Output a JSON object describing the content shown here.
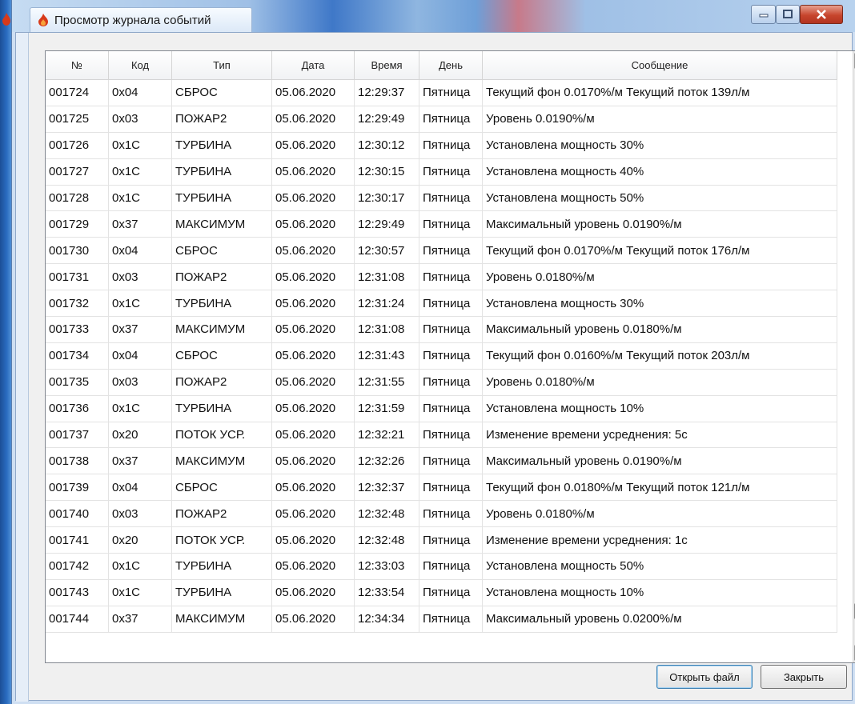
{
  "window": {
    "title": "Просмотр журнала событий"
  },
  "table": {
    "columns": [
      "№",
      "Код",
      "Тип",
      "Дата",
      "Время",
      "День",
      "Сообщение"
    ],
    "rows": [
      [
        "001724",
        "0x04",
        "СБРОС",
        "05.06.2020",
        "12:29:37",
        "Пятница",
        "Текущий фон 0.0170%/м Текущий поток 139л/м"
      ],
      [
        "001725",
        "0x03",
        "ПОЖАР2",
        "05.06.2020",
        "12:29:49",
        "Пятница",
        "Уровень 0.0190%/м"
      ],
      [
        "001726",
        "0x1C",
        "ТУРБИНА",
        "05.06.2020",
        "12:30:12",
        "Пятница",
        "Установлена мощность 30%"
      ],
      [
        "001727",
        "0x1C",
        "ТУРБИНА",
        "05.06.2020",
        "12:30:15",
        "Пятница",
        "Установлена мощность 40%"
      ],
      [
        "001728",
        "0x1C",
        "ТУРБИНА",
        "05.06.2020",
        "12:30:17",
        "Пятница",
        "Установлена мощность 50%"
      ],
      [
        "001729",
        "0x37",
        "МАКСИМУМ",
        "05.06.2020",
        "12:29:49",
        "Пятница",
        "Максимальный уровень 0.0190%/м"
      ],
      [
        "001730",
        "0x04",
        "СБРОС",
        "05.06.2020",
        "12:30:57",
        "Пятница",
        "Текущий фон 0.0170%/м Текущий поток 176л/м"
      ],
      [
        "001731",
        "0x03",
        "ПОЖАР2",
        "05.06.2020",
        "12:31:08",
        "Пятница",
        "Уровень 0.0180%/м"
      ],
      [
        "001732",
        "0x1C",
        "ТУРБИНА",
        "05.06.2020",
        "12:31:24",
        "Пятница",
        "Установлена мощность 30%"
      ],
      [
        "001733",
        "0x37",
        "МАКСИМУМ",
        "05.06.2020",
        "12:31:08",
        "Пятница",
        "Максимальный уровень 0.0180%/м"
      ],
      [
        "001734",
        "0x04",
        "СБРОС",
        "05.06.2020",
        "12:31:43",
        "Пятница",
        "Текущий фон 0.0160%/м Текущий поток 203л/м"
      ],
      [
        "001735",
        "0x03",
        "ПОЖАР2",
        "05.06.2020",
        "12:31:55",
        "Пятница",
        "Уровень 0.0180%/м"
      ],
      [
        "001736",
        "0x1C",
        "ТУРБИНА",
        "05.06.2020",
        "12:31:59",
        "Пятница",
        "Установлена мощность 10%"
      ],
      [
        "001737",
        "0x20",
        "ПОТОК УСР.",
        "05.06.2020",
        "12:32:21",
        "Пятница",
        "Изменение времени усреднения: 5с"
      ],
      [
        "001738",
        "0x37",
        "МАКСИМУМ",
        "05.06.2020",
        "12:32:26",
        "Пятница",
        "Максимальный уровень 0.0190%/м"
      ],
      [
        "001739",
        "0x04",
        "СБРОС",
        "05.06.2020",
        "12:32:37",
        "Пятница",
        "Текущий фон 0.0180%/м Текущий поток 121л/м"
      ],
      [
        "001740",
        "0x03",
        "ПОЖАР2",
        "05.06.2020",
        "12:32:48",
        "Пятница",
        "Уровень 0.0180%/м"
      ],
      [
        "001741",
        "0x20",
        "ПОТОК УСР.",
        "05.06.2020",
        "12:32:48",
        "Пятница",
        "Изменение времени усреднения: 1с"
      ],
      [
        "001742",
        "0x1C",
        "ТУРБИНА",
        "05.06.2020",
        "12:33:03",
        "Пятница",
        "Установлена мощность 50%"
      ],
      [
        "001743",
        "0x1C",
        "ТУРБИНА",
        "05.06.2020",
        "12:33:54",
        "Пятница",
        "Установлена мощность 10%"
      ],
      [
        "001744",
        "0x37",
        "МАКСИМУМ",
        "05.06.2020",
        "12:34:34",
        "Пятница",
        "Максимальный уровень 0.0200%/м"
      ]
    ]
  },
  "buttons": {
    "open_file": "Открыть файл",
    "close": "Закрыть"
  },
  "icons": {
    "app": "flame-icon",
    "minimize": "minimize-icon",
    "maximize": "maximize-icon",
    "close": "close-icon",
    "scroll_up": "arrow-up-icon",
    "scroll_down": "arrow-down-icon"
  },
  "colors": {
    "flame": "#d83a1a",
    "close_button": "#c7452d",
    "header_bg": "#f1f2f4"
  }
}
